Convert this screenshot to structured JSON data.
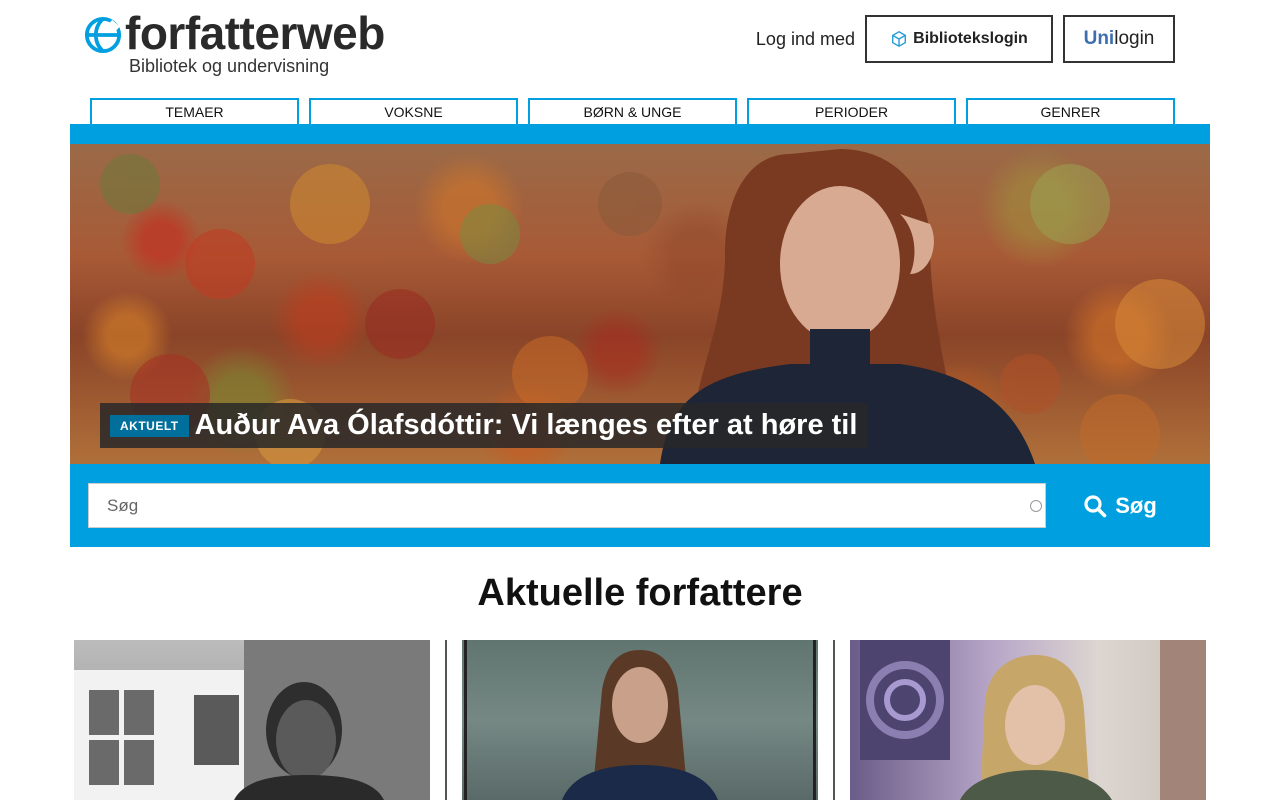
{
  "header": {
    "site_name": "forfatterweb",
    "tagline": "Bibliotek og undervisning",
    "login_prompt": "Log ind med",
    "library_login_label": "Bibliotekslogin",
    "unilogin_prefix": "Uni",
    "unilogin_suffix": "login"
  },
  "nav": {
    "tabs": [
      {
        "label": "TEMAER"
      },
      {
        "label": "VOKSNE"
      },
      {
        "label": "BØRN & UNGE"
      },
      {
        "label": "PERIODER"
      },
      {
        "label": "GENRER"
      }
    ]
  },
  "hero": {
    "badge": "AKTUELT",
    "title": "Auður Ava Ólafsdóttir: Vi længes efter at høre til"
  },
  "search": {
    "placeholder": "Søg",
    "value": "",
    "button_label": "Søg"
  },
  "section": {
    "title": "Aktuelle forfattere"
  },
  "colors": {
    "accent": "#009fe0",
    "badge": "#006f9c",
    "unilogin_accent": "#3d6fb0"
  },
  "icons": [
    "globe-logo-icon",
    "cube-icon",
    "search-icon"
  ]
}
